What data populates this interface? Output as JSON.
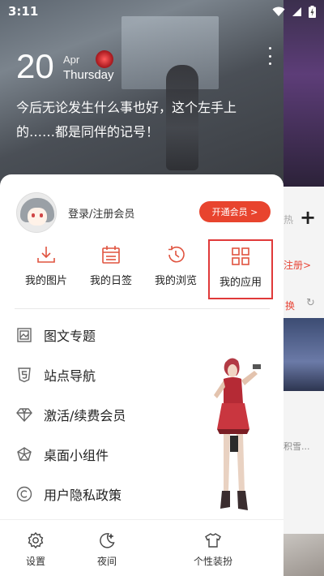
{
  "status_bar": {
    "time": "3:11"
  },
  "header": {
    "day": "20",
    "month": "Apr",
    "weekday": "Thursday",
    "quote": "今后无论发生什么事也好，这个左手上的……都是同伴的记号！"
  },
  "background_peek": {
    "hot_label": "热",
    "register_link": "注册>",
    "switch_label": "换",
    "caption": "积雪..."
  },
  "profile": {
    "login_label": "登录/注册会员",
    "vip_button": "开通会员 >"
  },
  "quick_actions": [
    {
      "label": "我的图片",
      "icon": "download-icon"
    },
    {
      "label": "我的日签",
      "icon": "calendar-icon"
    },
    {
      "label": "我的浏览",
      "icon": "history-icon"
    },
    {
      "label": "我的应用",
      "icon": "apps-grid-icon",
      "highlighted": true
    }
  ],
  "menu": [
    {
      "label": "图文专题",
      "icon": "image-frame-icon"
    },
    {
      "label": "站点导航",
      "icon": "html5-icon"
    },
    {
      "label": "激活/续费会员",
      "icon": "diamond-icon"
    },
    {
      "label": "桌面小组件",
      "icon": "widget-icon"
    },
    {
      "label": "用户隐私政策",
      "icon": "copyright-icon"
    }
  ],
  "bottom_bar": [
    {
      "label": "设置",
      "icon": "gear-icon"
    },
    {
      "label": "夜间",
      "icon": "moon-icon"
    },
    {
      "label": "个性装扮",
      "icon": "shirt-icon"
    }
  ],
  "colors": {
    "accent": "#e8442e",
    "highlight_border": "#e03a3a",
    "icon_red": "#e0533f"
  }
}
